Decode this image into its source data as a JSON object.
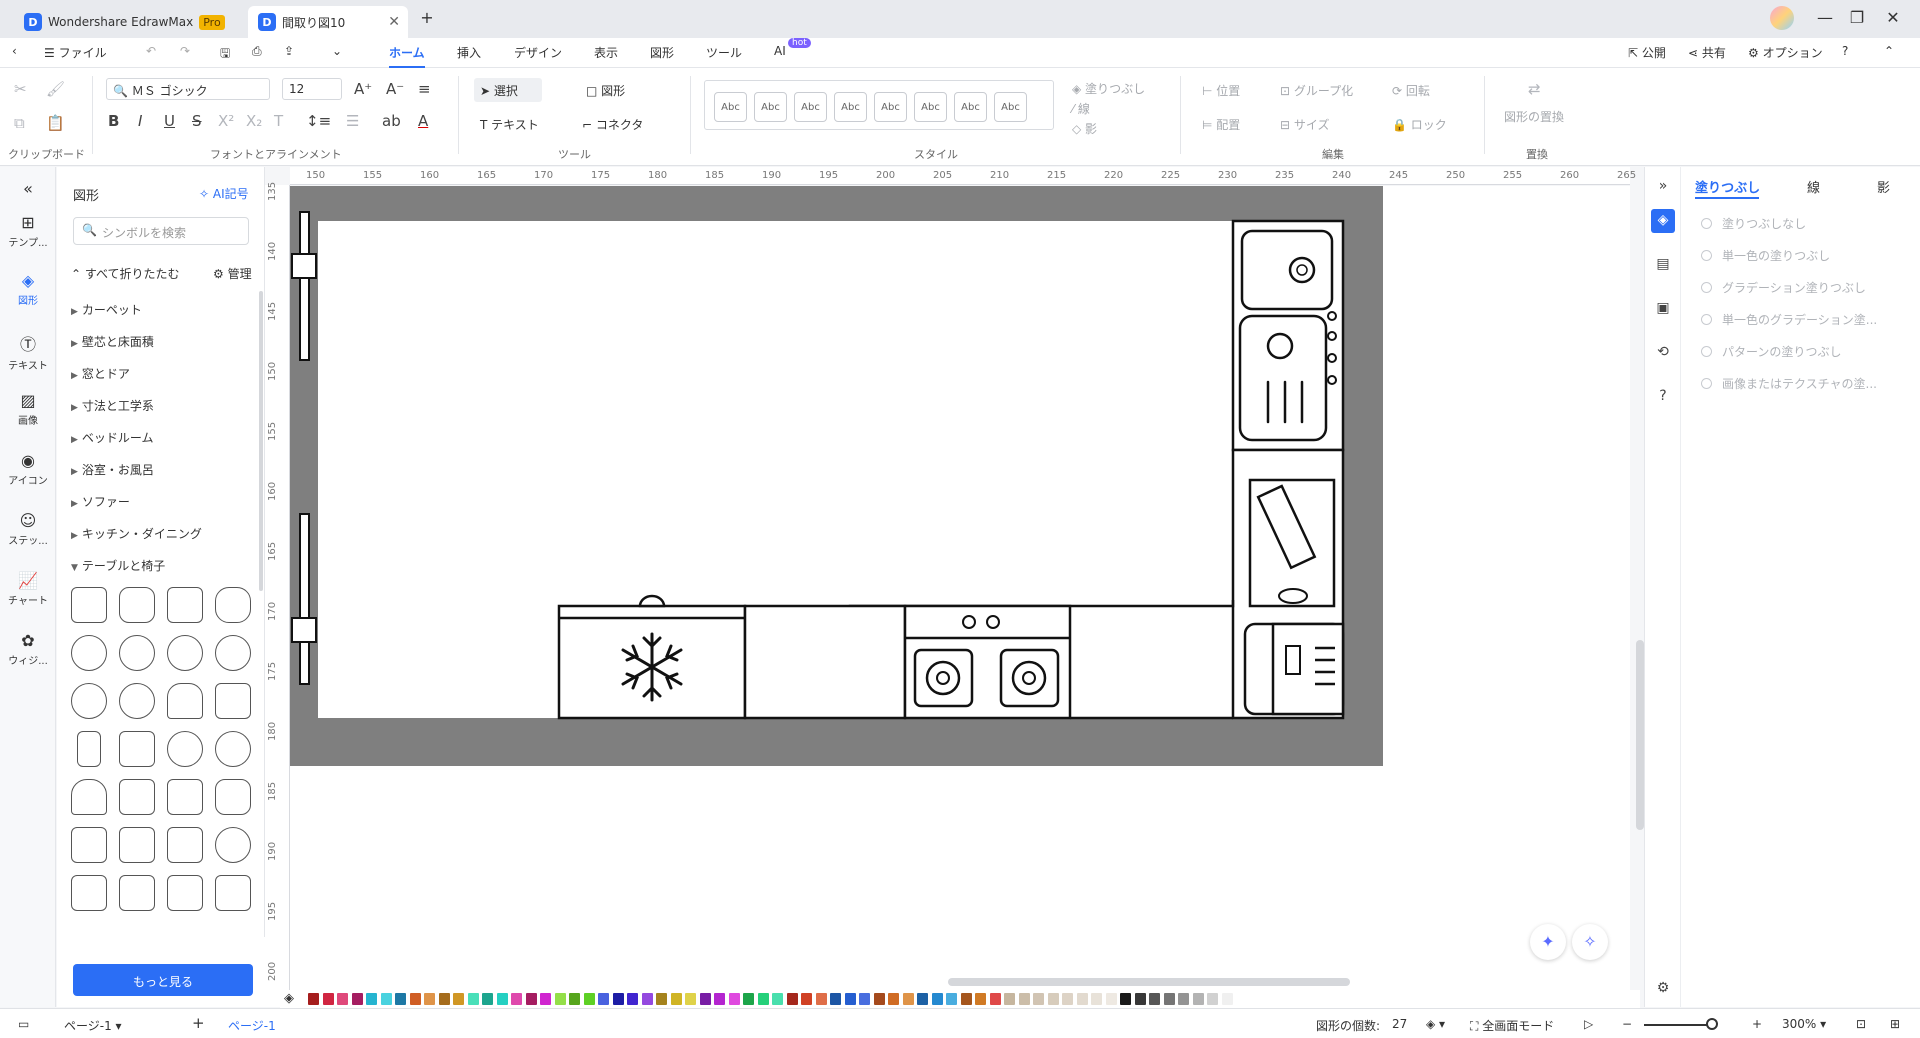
{
  "titlebar": {
    "app_tab": "Wondershare EdrawMax",
    "pro": "Pro",
    "doc_tab": "間取り図10",
    "logo": "D"
  },
  "menubar": {
    "file": "ファイル",
    "items": [
      "ホーム",
      "挿入",
      "デザイン",
      "表示",
      "図形",
      "ツール",
      "AI"
    ],
    "hot": "hot",
    "publish": "公開",
    "share": "共有",
    "options": "オプション"
  },
  "ribbon": {
    "font_name": "ＭＳ ゴシック",
    "font_size": "12",
    "select": "選択",
    "shape": "図形",
    "text": "テキスト",
    "connector": "コネクタ",
    "style_sample": "Abc",
    "fill": "塗りつぶし",
    "line": "線",
    "shadow": "影",
    "position": "位置",
    "group": "グループ化",
    "rotate": "回転",
    "align": "配置",
    "size": "サイズ",
    "lock": "ロック",
    "replace": "図形の置換",
    "groups": {
      "clipboard": "クリップボード",
      "font": "フォントとアラインメント",
      "tools": "ツール",
      "style": "スタイル",
      "edit": "編集",
      "replace": "置換"
    }
  },
  "leftrail": {
    "items": [
      "テンプ...",
      "図形",
      "テキスト",
      "画像",
      "アイコン",
      "ステッ...",
      "チャート",
      "ウィジ..."
    ]
  },
  "shapepanel": {
    "title": "図形",
    "ai_button": "AI記号",
    "search_placeholder": "シンボルを検索",
    "collapse_all": "すべて折りたたむ",
    "manage": "管理",
    "categories": [
      "カーペット",
      "壁芯と床面積",
      "窓とドア",
      "寸法と工学系",
      "ベッドルーム",
      "浴室・お風呂",
      "ソファー",
      "キッチン・ダイニング",
      "テーブルと椅子"
    ],
    "more": "もっと見る"
  },
  "rulers": {
    "top": [
      "150",
      "155",
      "160",
      "165",
      "170",
      "175",
      "180",
      "185",
      "190",
      "195",
      "200",
      "205",
      "210",
      "215",
      "220",
      "225",
      "230",
      "235",
      "240",
      "245",
      "250",
      "255",
      "260",
      "265"
    ],
    "left": [
      "135",
      "140",
      "145",
      "150",
      "155",
      "160",
      "165",
      "170",
      "175",
      "180",
      "185",
      "190",
      "195",
      "200"
    ]
  },
  "rightpanel": {
    "tabs": [
      "塗りつぶし",
      "線",
      "影"
    ],
    "fill_options": [
      "塗りつぶしなし",
      "単一色の塗りつぶし",
      "グラデーション塗りつぶし",
      "単一色のグラデーション塗...",
      "パターンの塗りつぶし",
      "画像またはテクスチャの塗..."
    ]
  },
  "statusbar": {
    "page_select": "ページ-1",
    "page_tab": "ページ-1",
    "shape_count_label": "図形の個数:",
    "shape_count": "27",
    "fullscreen": "全画面モード",
    "zoom": "300%"
  },
  "colors": {
    "accent": "#2b6ef5",
    "wall": "#7f7f7f"
  }
}
